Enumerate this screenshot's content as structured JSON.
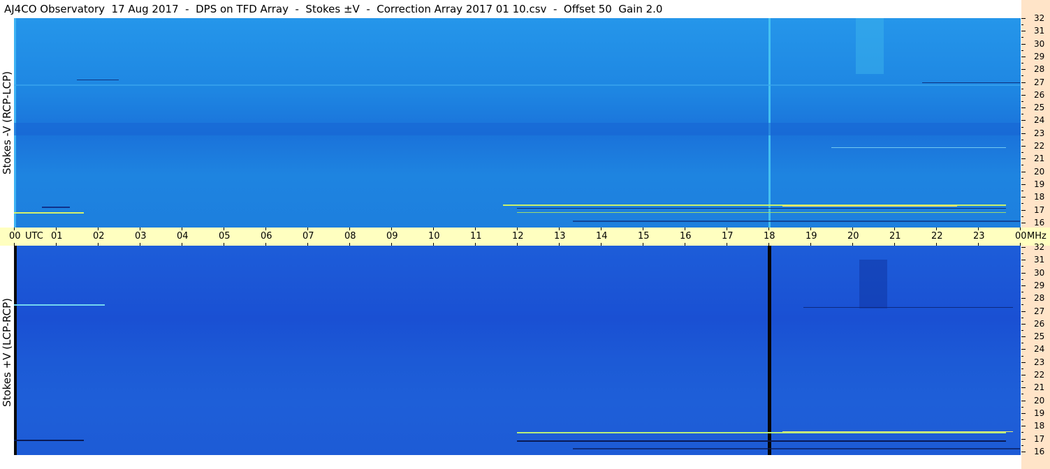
{
  "title": "AJ4CO Observatory  17 Aug 2017  -  DPS on TFD Array  -  Stokes ±V  -  Correction Array 2017 01 10.csv  -  Offset 50  Gain 2.0",
  "panels": {
    "top_label": "Stokes -V (RCP-LCP)",
    "bottom_label": "Stokes +V (LCP-RCP)"
  },
  "time_axis": {
    "labels": [
      "00",
      "01",
      "02",
      "03",
      "04",
      "05",
      "06",
      "07",
      "08",
      "09",
      "10",
      "11",
      "12",
      "13",
      "14",
      "15",
      "16",
      "17",
      "18",
      "19",
      "20",
      "21",
      "22",
      "23",
      "00"
    ],
    "unit_left": "UTC",
    "unit_right": "MHz"
  },
  "freq_axis": {
    "labels": [
      "32",
      "31",
      "30",
      "29",
      "28",
      "27",
      "26",
      "25",
      "24",
      "23",
      "22",
      "21",
      "20",
      "19",
      "18",
      "17",
      "16"
    ]
  },
  "colors": {
    "top_background": "#1f8ee6",
    "bottom_background": "#1a4fd6",
    "axis_band": "#ffffc0",
    "freq_band": "#ffe4c8"
  }
}
